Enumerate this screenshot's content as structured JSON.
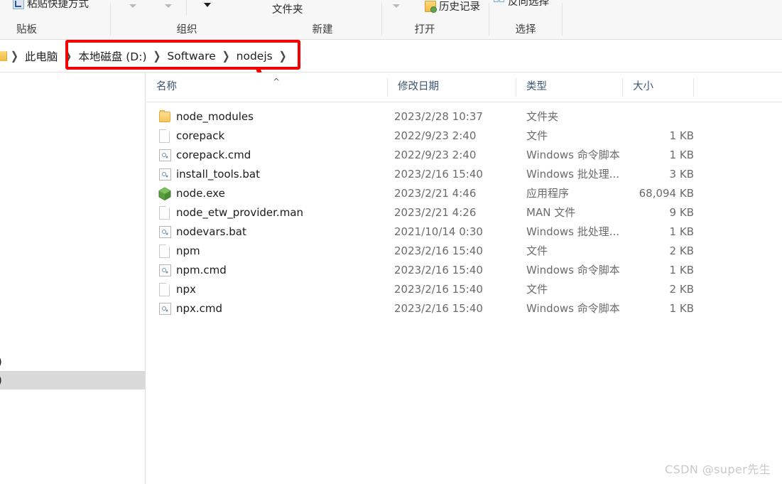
{
  "ribbon": {
    "groups": [
      {
        "label": "贴板"
      },
      {
        "label": "组织"
      },
      {
        "label": "新建"
      },
      {
        "label": "打开"
      },
      {
        "label": "选择"
      }
    ],
    "commands": {
      "paste_shortcut": "粘贴快捷方式",
      "new_folder": "文件夹",
      "history": "历史记录",
      "invert_selection": "反向选择"
    }
  },
  "address": {
    "crumbs": [
      {
        "label": "此电脑"
      },
      {
        "label": "本地磁盘 (D:)"
      },
      {
        "label": "Software"
      },
      {
        "label": "nodejs"
      }
    ],
    "chevron": "❯",
    "highlight_color": "#f40000"
  },
  "nav": {
    "items": [
      {
        "label": ":)",
        "selected": false
      },
      {
        "label": ":)",
        "selected": true
      }
    ]
  },
  "columns": {
    "name": "名称",
    "date": "修改日期",
    "type": "类型",
    "size": "大小",
    "sort_indicator": "^"
  },
  "files": [
    {
      "icon": "folder-icon",
      "name": "node_modules",
      "date": "2023/2/28 10:37",
      "type": "文件夹",
      "size": ""
    },
    {
      "icon": "file-icon",
      "name": "corepack",
      "date": "2022/9/23 2:40",
      "type": "文件",
      "size": "1 KB"
    },
    {
      "icon": "script-icon",
      "name": "corepack.cmd",
      "date": "2022/9/23 2:40",
      "type": "Windows 命令脚本",
      "size": "1 KB"
    },
    {
      "icon": "script-icon",
      "name": "install_tools.bat",
      "date": "2023/2/16 15:40",
      "type": "Windows 批处理...",
      "size": "3 KB"
    },
    {
      "icon": "node-icon",
      "name": "node.exe",
      "date": "2023/2/21 4:46",
      "type": "应用程序",
      "size": "68,094 KB"
    },
    {
      "icon": "file-icon",
      "name": "node_etw_provider.man",
      "date": "2023/2/21 4:26",
      "type": "MAN 文件",
      "size": "9 KB"
    },
    {
      "icon": "script-icon",
      "name": "nodevars.bat",
      "date": "2021/10/14 0:30",
      "type": "Windows 批处理...",
      "size": "1 KB"
    },
    {
      "icon": "file-icon",
      "name": "npm",
      "date": "2023/2/16 15:40",
      "type": "文件",
      "size": "2 KB"
    },
    {
      "icon": "script-icon",
      "name": "npm.cmd",
      "date": "2023/2/16 15:40",
      "type": "Windows 命令脚本",
      "size": "1 KB"
    },
    {
      "icon": "file-icon",
      "name": "npx",
      "date": "2023/2/16 15:40",
      "type": "文件",
      "size": "2 KB"
    },
    {
      "icon": "script-icon",
      "name": "npx.cmd",
      "date": "2023/2/16 15:40",
      "type": "Windows 命令脚本",
      "size": "1 KB"
    }
  ],
  "watermark": "CSDN @super先生"
}
